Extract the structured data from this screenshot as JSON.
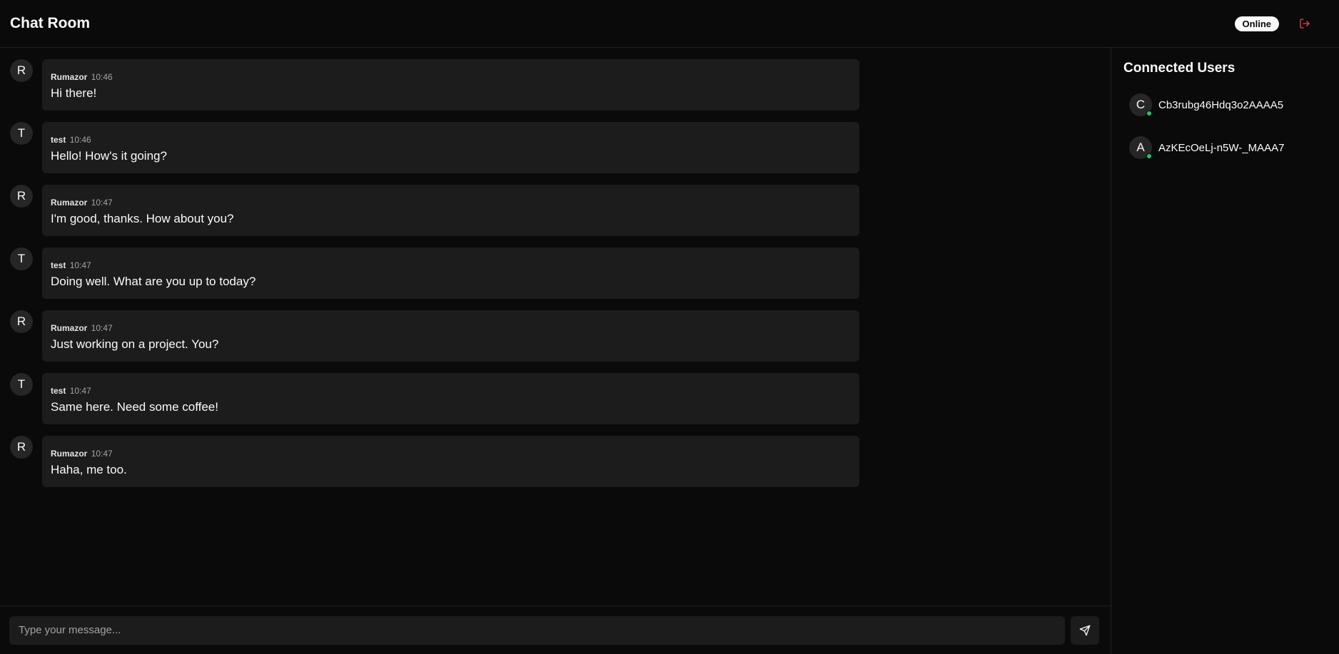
{
  "header": {
    "title": "Chat Room",
    "status": "Online",
    "logout_icon": "log-out-icon",
    "logout_color": "#ef4444"
  },
  "messages": [
    {
      "initial": "R",
      "author": "Rumazor",
      "time": "10:46",
      "text": "Hi there!"
    },
    {
      "initial": "T",
      "author": "test",
      "time": "10:46",
      "text": "Hello! How's it going?"
    },
    {
      "initial": "R",
      "author": "Rumazor",
      "time": "10:47",
      "text": "I'm good, thanks. How about you?"
    },
    {
      "initial": "T",
      "author": "test",
      "time": "10:47",
      "text": "Doing well. What are you up to today?"
    },
    {
      "initial": "R",
      "author": "Rumazor",
      "time": "10:47",
      "text": "Just working on a project. You?"
    },
    {
      "initial": "T",
      "author": "test",
      "time": "10:47",
      "text": "Same here. Need some coffee!"
    },
    {
      "initial": "R",
      "author": "Rumazor",
      "time": "10:47",
      "text": "Haha, me too."
    }
  ],
  "composer": {
    "placeholder": "Type your message...",
    "value": "",
    "send_icon": "send-icon"
  },
  "sidebar": {
    "title": "Connected Users",
    "users": [
      {
        "initial": "C",
        "name": "Cb3rubg46Hdq3o2AAAA5",
        "online": true
      },
      {
        "initial": "A",
        "name": "AzKEcOeLj-n5W-_MAAA7",
        "online": true
      }
    ],
    "online_color": "#22c55e"
  }
}
